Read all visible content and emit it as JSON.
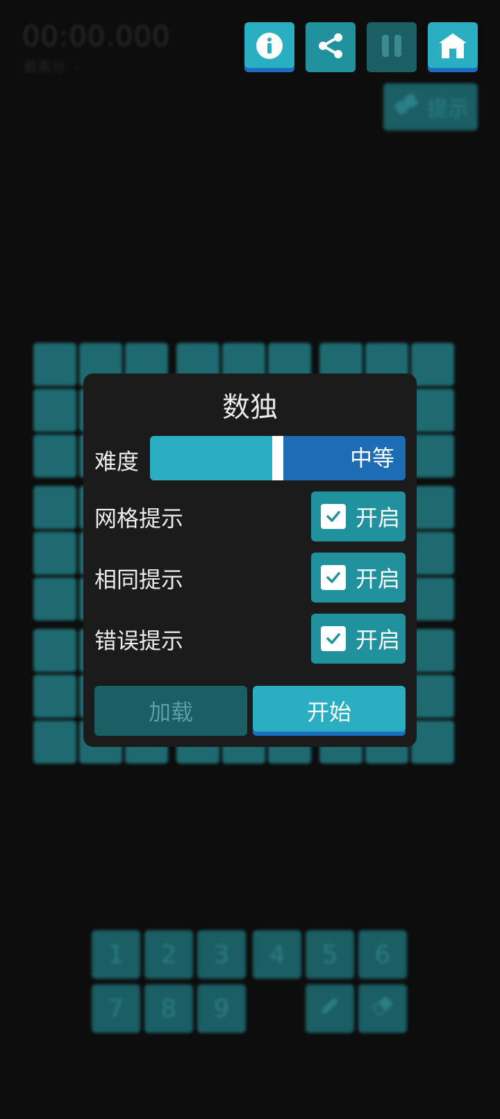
{
  "header": {
    "timer": "00:00.000",
    "best_score_label": "最高分: -",
    "hint_label": "提示"
  },
  "toolbar": {
    "info_icon": "info-icon",
    "share_icon": "share-icon",
    "pause_icon": "pause-icon",
    "home_icon": "home-icon"
  },
  "keypad": {
    "keys": [
      "1",
      "2",
      "3",
      "4",
      "5",
      "6",
      "7",
      "8",
      "9"
    ],
    "pencil_icon": "pencil-icon",
    "eraser_icon": "eraser-icon"
  },
  "dialog": {
    "title": "数独",
    "difficulty": {
      "label": "难度",
      "value": "中等",
      "level_fraction": 0.5
    },
    "options": [
      {
        "label": "网格提示",
        "state": "开启",
        "checked": true
      },
      {
        "label": "相同提示",
        "state": "开启",
        "checked": true
      },
      {
        "label": "错误提示",
        "state": "开启",
        "checked": true
      }
    ],
    "load_label": "加载",
    "start_label": "开始"
  },
  "colors": {
    "accent": "#2aaec2",
    "accent_dark": "#1b5e63",
    "accent_blue": "#1c6db3",
    "dialog_bg": "#1b1b1b",
    "page_bg": "#0d0d0d"
  }
}
